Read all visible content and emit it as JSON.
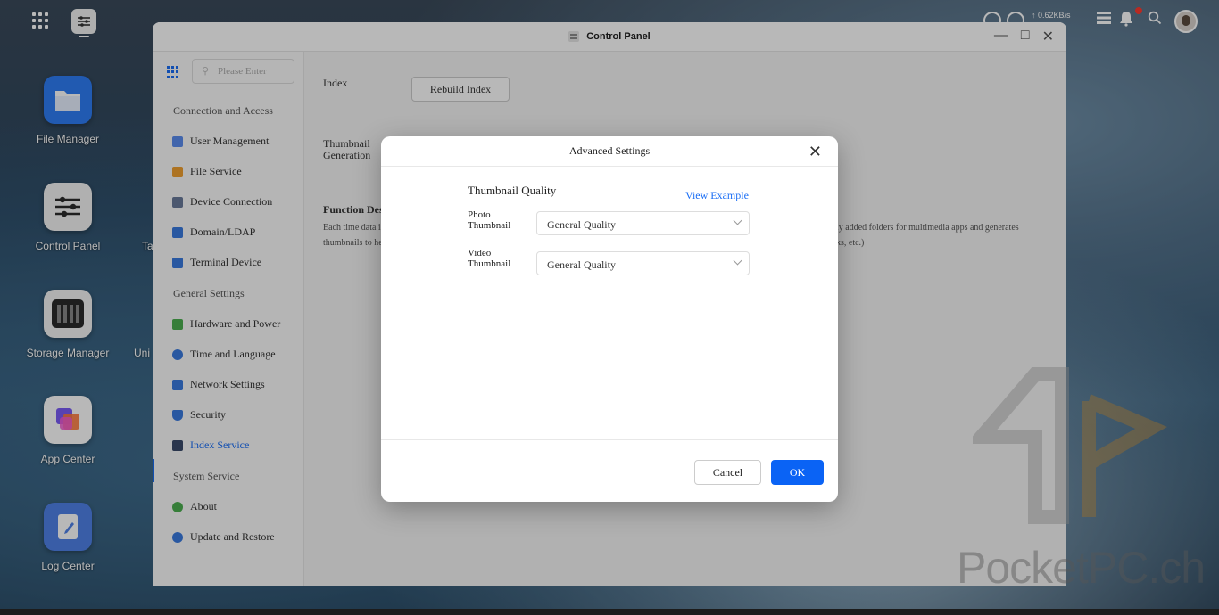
{
  "topbar": {
    "speed": "↑ 0.62KB/s"
  },
  "desktop": {
    "icons": [
      {
        "label": "File Manager"
      },
      {
        "label": "Control Panel"
      },
      {
        "label": "Storage Manager"
      },
      {
        "label": "App Center"
      },
      {
        "label": "Log Center"
      }
    ],
    "partial_labels": [
      "Ta",
      "Uni"
    ]
  },
  "window": {
    "title": "Control Panel"
  },
  "sidebar": {
    "search_placeholder": "Please Enter",
    "sections": [
      {
        "title": "Connection and Access"
      },
      {
        "title": "General Settings"
      },
      {
        "title": "System Service"
      }
    ],
    "items": [
      {
        "label": "User Management",
        "color": "#5b8def"
      },
      {
        "label": "File Service",
        "color": "#f0a030"
      },
      {
        "label": "Device Connection",
        "color": "#6a7a9a"
      },
      {
        "label": "Domain/LDAP",
        "color": "#3a7ae0"
      },
      {
        "label": "Terminal Device",
        "color": "#3a7ae0"
      },
      {
        "label": "Hardware and Power",
        "color": "#4caf50"
      },
      {
        "label": "Time and Language",
        "color": "#3a7ae0"
      },
      {
        "label": "Network Settings",
        "color": "#3a7ae0"
      },
      {
        "label": "Security",
        "color": "#3a7ae0"
      },
      {
        "label": "Index Service",
        "color": "#3a4a6a"
      },
      {
        "label": "About",
        "color": "#4caf50"
      },
      {
        "label": "Update and Restore",
        "color": "#3a7ae0"
      }
    ]
  },
  "main": {
    "index_label": "Index",
    "rebuild_label": "Rebuild Index",
    "thumbnail_label_1": "Thumbnail",
    "thumbnail_label_2": "Generation",
    "func_title": "Function Des",
    "func_line1_left": "Each time data is",
    "func_line1_right": "ly added folders for multimedia apps and generates",
    "func_line2_left": "thumbnails to he",
    "func_line2_right": "ks, etc.)"
  },
  "modal": {
    "title": "Advanced Settings",
    "section_title": "Thumbnail Quality",
    "view_example": "View Example",
    "photo_label_1": "Photo",
    "photo_label_2": "Thumbnail",
    "photo_value": "General Quality",
    "video_label_1": "Video",
    "video_label_2": "Thumbnail",
    "video_value": "General Quality",
    "cancel": "Cancel",
    "ok": "OK"
  },
  "watermark": {
    "text": "PocketPC.ch"
  }
}
